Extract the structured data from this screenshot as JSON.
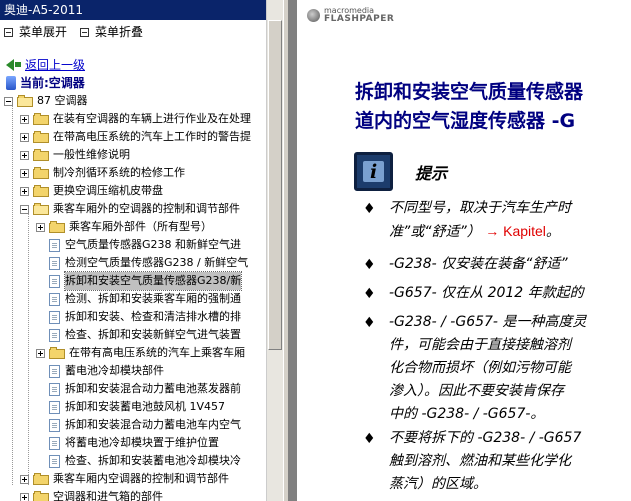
{
  "window": {
    "title": "奥迪-A5-2011"
  },
  "toolbar": {
    "expand": "菜单展开",
    "collapse": "菜单折叠"
  },
  "nav": {
    "back": "返回上一级",
    "current": "当前:空调器"
  },
  "tree": [
    {
      "label": "87 空调器",
      "type": "folder",
      "state": "open",
      "level": 0
    },
    {
      "label": "在装有空调器的车辆上进行作业及在处理",
      "type": "folder",
      "state": "closed",
      "level": 1
    },
    {
      "label": "在带高电压系统的汽车上工作时的警告提",
      "type": "folder",
      "state": "closed",
      "level": 1
    },
    {
      "label": "一般性维修说明",
      "type": "folder",
      "state": "closed",
      "level": 1
    },
    {
      "label": "制冷剂循环系统的检修工作",
      "type": "folder",
      "state": "closed",
      "level": 1
    },
    {
      "label": "更换空调压缩机皮带盘",
      "type": "folder",
      "state": "closed",
      "level": 1
    },
    {
      "label": "乘客车厢外的空调器的控制和调节部件",
      "type": "folder",
      "state": "open",
      "level": 1
    },
    {
      "label": "乘客车厢外部件（所有型号）",
      "type": "folder",
      "state": "closed",
      "level": 2
    },
    {
      "label": "空气质量传感器G238 和新鲜空气进",
      "type": "doc",
      "level": 2
    },
    {
      "label": "检测空气质量传感器G238 / 新鲜空气",
      "type": "doc",
      "level": 2
    },
    {
      "label": "拆卸和安装空气质量传感器G238/新",
      "type": "doc",
      "level": 2,
      "selected": true
    },
    {
      "label": "检测、拆卸和安装乘客车厢的强制通",
      "type": "doc",
      "level": 2
    },
    {
      "label": "拆卸和安装、检查和清洁排水槽的排",
      "type": "doc",
      "level": 2
    },
    {
      "label": "检查、拆卸和安装新鲜空气进气装置",
      "type": "doc",
      "level": 2
    },
    {
      "label": "在带有高电压系统的汽车上乘客车厢",
      "type": "folder",
      "state": "closed",
      "level": 2
    },
    {
      "label": "蓄电池冷却模块部件",
      "type": "doc",
      "level": 2
    },
    {
      "label": "拆卸和安装混合动力蓄电池蒸发器前",
      "type": "doc",
      "level": 2
    },
    {
      "label": "拆卸和安装蓄电池鼓风机 1V457",
      "type": "doc",
      "level": 2
    },
    {
      "label": "拆卸和安装混合动力蓄电池车内空气",
      "type": "doc",
      "level": 2
    },
    {
      "label": "将蓄电池冷却模块置于维护位置",
      "type": "doc",
      "level": 2
    },
    {
      "label": "检查、拆卸和安装蓄电池冷却模块冷",
      "type": "doc",
      "level": 2
    },
    {
      "label": "乘客车厢内空调器的控制和调节部件",
      "type": "folder",
      "state": "closed",
      "level": 1
    },
    {
      "label": "空调器和进气箱的部件",
      "type": "folder",
      "state": "closed",
      "level": 1
    }
  ],
  "viewer": {
    "brand_top": "macromedia",
    "brand_bottom": "FLASHPAPER",
    "heading_line1": "拆卸和安装空气质量传感器",
    "heading_line2": "道内的空气湿度传感器  -G",
    "tip_title": "提示",
    "bullets": [
      {
        "lines": [
          "不同型号，取决于汽车生产时",
          "准”或“舒适”） "
        ],
        "link": "→ Kapitel",
        "link_tail": "。"
      },
      {
        "lines": [
          "-G238- 仅安装在装备“舒适”"
        ]
      },
      {
        "lines": [
          "-G657- 仅在从  2012 年款起的"
        ]
      },
      {
        "lines": [
          "-G238- / -G657- 是一种高度灵",
          "件，可能会由于直接接触溶剂",
          "化合物而损坏（例如污物可能",
          "渗入）。因此不要安装肯保存",
          "中的 -G238- / -G657-。"
        ]
      },
      {
        "lines": [
          "不要将拆下的 -G238- / -G657",
          "触到溶剂、燃油和某些化学化",
          "蒸汽）的区域。"
        ]
      }
    ],
    "bullet_glyph": "♦"
  }
}
